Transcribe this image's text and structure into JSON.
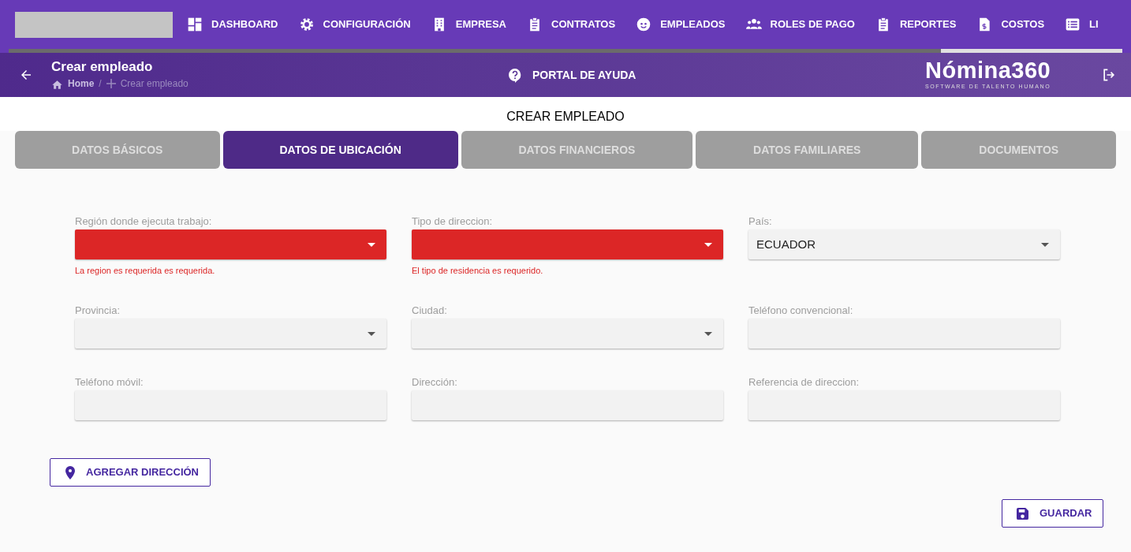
{
  "nav": {
    "items": [
      {
        "label": "DASHBOARD"
      },
      {
        "label": "CONFIGURACIÓN"
      },
      {
        "label": "EMPRESA"
      },
      {
        "label": "CONTRATOS"
      },
      {
        "label": "EMPLEADOS"
      },
      {
        "label": "ROLES DE PAGO"
      },
      {
        "label": "REPORTES"
      },
      {
        "label": "COSTOS"
      },
      {
        "label": "LI"
      }
    ]
  },
  "header": {
    "title": "Crear empleado",
    "breadcrumb": [
      "Home",
      "Crear empleado"
    ],
    "breadcrumb_separator": "/",
    "help": "PORTAL DE AYUDA",
    "brand": "Nómina360",
    "brand_tagline": "SOFTWARE DE TALENTO HUMANO"
  },
  "page_title": "CREAR EMPLEADO",
  "tabs": [
    {
      "label": "DATOS BÁSICOS",
      "selected": false
    },
    {
      "label": "DATOS DE UBICACIÓN",
      "selected": true
    },
    {
      "label": "DATOS FINANCIEROS",
      "selected": false
    },
    {
      "label": "DATOS FAMILIARES",
      "selected": false
    },
    {
      "label": "DOCUMENTOS",
      "selected": false
    }
  ],
  "fields": [
    {
      "label": "Región donde ejecuta trabajo:",
      "kind": "select",
      "invalid": true,
      "error": "La region es requerida es requerida."
    },
    {
      "label": "Tipo de direccion:",
      "kind": "select",
      "invalid": true,
      "error": "El tipo de residencia es requerido."
    },
    {
      "label": "País:",
      "kind": "select",
      "invalid": false,
      "value": "ECUADOR"
    },
    {
      "label": "Provincia:",
      "kind": "select",
      "invalid": false
    },
    {
      "label": "Ciudad:",
      "kind": "select",
      "invalid": false
    },
    {
      "label": "Teléfono convencional:",
      "kind": "text",
      "invalid": false
    },
    {
      "label": "Teléfono móvil:",
      "kind": "text",
      "invalid": false
    },
    {
      "label": "Dirección:",
      "kind": "text",
      "invalid": false
    },
    {
      "label": "Referencia de direccion:",
      "kind": "text",
      "invalid": false
    }
  ],
  "add_button": "AGREGAR DIRECCIÓN",
  "save_button": "GUARDAR"
}
